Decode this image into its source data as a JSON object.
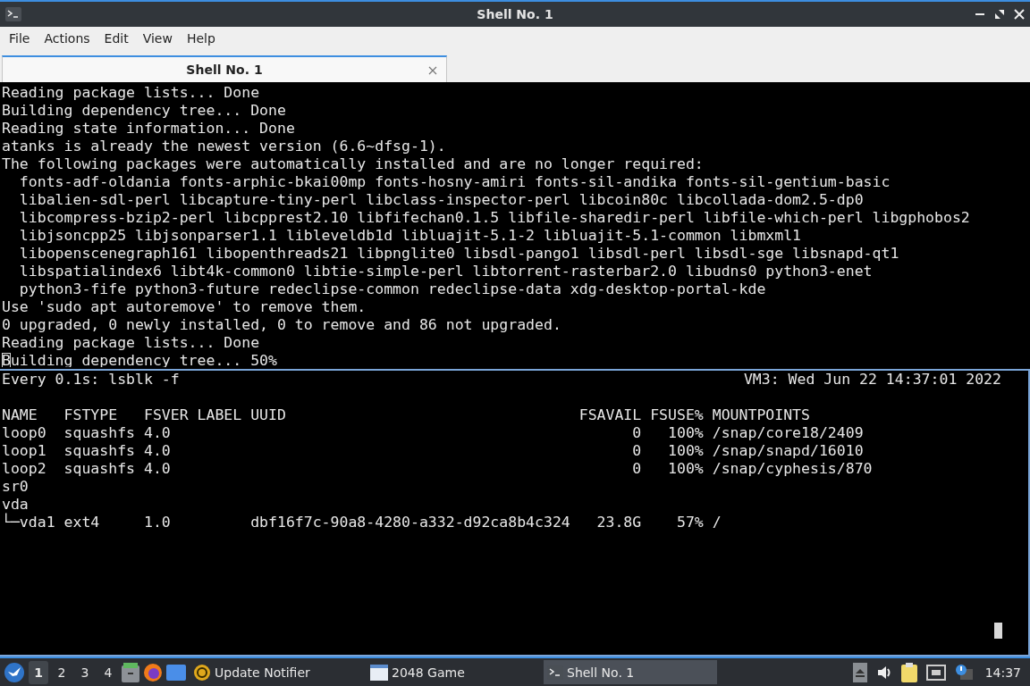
{
  "window": {
    "title": "Shell No. 1"
  },
  "menu": [
    "File",
    "Actions",
    "Edit",
    "View",
    "Help"
  ],
  "tabs": [
    {
      "label": "Shell No. 1",
      "selected": true
    }
  ],
  "top_pane": {
    "focused": false,
    "lines": [
      "Reading package lists... Done",
      "Building dependency tree... Done",
      "Reading state information... Done",
      "atanks is already the newest version (6.6~dfsg-1).",
      "The following packages were automatically installed and are no longer required:",
      "  fonts-adf-oldania fonts-arphic-bkai00mp fonts-hosny-amiri fonts-sil-andika fonts-sil-gentium-basic",
      "  libalien-sdl-perl libcapture-tiny-perl libclass-inspector-perl libcoin80c libcollada-dom2.5-dp0",
      "  libcompress-bzip2-perl libcpprest2.10 libfifechan0.1.5 libfile-sharedir-perl libfile-which-perl libgphobos2",
      "  libjsoncpp25 libjsonparser1.1 libleveldb1d libluajit-5.1-2 libluajit-5.1-common libmxml1",
      "  libopenscenegraph161 libopenthreads21 libpnglite0 libsdl-pango1 libsdl-perl libsdl-sge libsnapd-qt1",
      "  libspatialindex6 libt4k-common0 libtie-simple-perl libtorrent-rasterbar2.0 libudns0 python3-enet",
      "  python3-fife python3-future redeclipse-common redeclipse-data xdg-desktop-portal-kde",
      "Use 'sudo apt autoremove' to remove them.",
      "0 upgraded, 0 newly installed, 0 to remove and 86 not upgraded.",
      "Reading package lists... Done",
      "Building dependency tree... 50%"
    ]
  },
  "bottom_pane": {
    "focused": true,
    "header_left": "Every 0.1s: lsblk -f",
    "header_right": "VM3: Wed Jun 22 14:37:01 2022",
    "lines": [
      "NAME   FSTYPE   FSVER LABEL UUID                                 FSAVAIL FSUSE% MOUNTPOINTS",
      "loop0  squashfs 4.0                                                    0   100% /snap/core18/2409",
      "loop1  squashfs 4.0                                                    0   100% /snap/snapd/16010",
      "loop2  squashfs 4.0                                                    0   100% /snap/cyphesis/870",
      "sr0",
      "vda",
      "└─vda1 ext4     1.0         dbf16f7c-90a8-4280-a332-d92ca8b4c324   23.8G    57% /"
    ]
  },
  "taskbar": {
    "desktops": [
      {
        "label": "1",
        "selected": true
      },
      {
        "label": "2",
        "selected": false
      },
      {
        "label": "3",
        "selected": false
      },
      {
        "label": "4",
        "selected": false
      }
    ],
    "tasks": [
      {
        "kind": "updater",
        "label": "Update Notifier",
        "selected": false
      },
      {
        "kind": "window",
        "label": "2048 Game",
        "selected": false
      },
      {
        "kind": "terminal",
        "label": "Shell No. 1",
        "selected": true
      }
    ],
    "clock": "14:37"
  }
}
